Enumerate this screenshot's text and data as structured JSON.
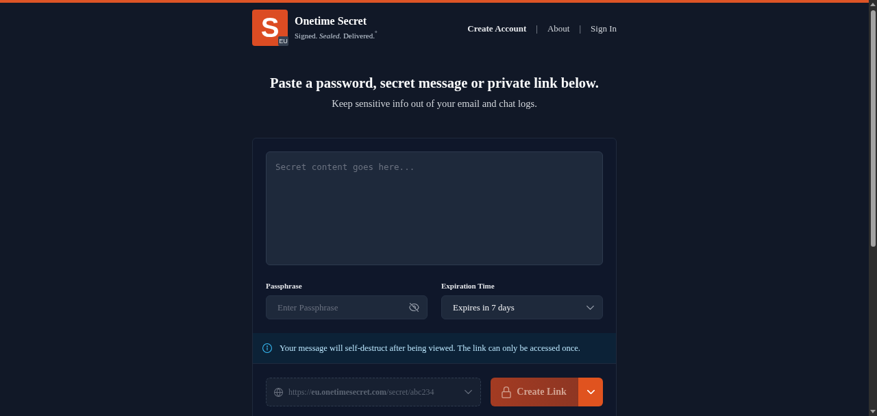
{
  "header": {
    "logo": {
      "letter": "S",
      "badge": "EU"
    },
    "title": "Onetime Secret",
    "tagline": "Signed. *Sealed.* Delivered.$^{°}$",
    "nav": [
      {
        "kind": "link",
        "label": "Create Account",
        "primary": true
      },
      {
        "kind": "separator",
        "label": "|"
      },
      {
        "kind": "link",
        "label": "About",
        "primary": false
      },
      {
        "kind": "separator",
        "label": "|"
      },
      {
        "kind": "link",
        "label": "Sign In",
        "primary": false
      }
    ]
  },
  "hero": {
    "title": "Paste a password, secret message or private link below.",
    "subtitle": "Keep sensitive info out of your email and chat logs."
  },
  "form": {
    "secret": {
      "placeholder": "Secret content goes here..."
    },
    "passphrase": {
      "label": "Passphrase",
      "placeholder": "Enter Passphrase",
      "visible": false
    },
    "expiration": {
      "label": "Expiration Time",
      "value": "Expires in 7 days"
    },
    "notice": "Your message will self-destruct after being viewed. The link can only be accessed once.",
    "share_link": {
      "url": "https://**eu.onetimesecret.com**/secret/abc234"
    },
    "submit": {
      "label": "Create Link",
      "disabled": true
    }
  }
}
